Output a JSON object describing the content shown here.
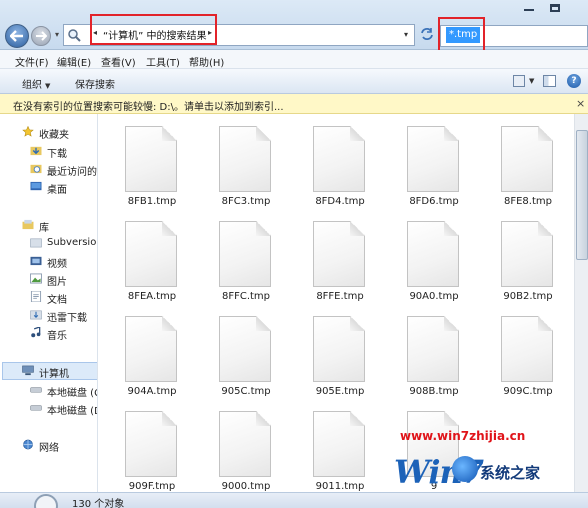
{
  "address": {
    "breadcrumb": "“计算机” 中的搜索结果",
    "search_query": "*.tmp"
  },
  "menu": {
    "items": [
      "文件(F)",
      "编辑(E)",
      "查看(V)",
      "工具(T)",
      "帮助(H)"
    ]
  },
  "toolbar": {
    "organize_label": "组织",
    "save_search_label": "保存搜索"
  },
  "infobar": {
    "text": "在没有索引的位置搜索可能较慢: D:\\。请单击以添加到索引..."
  },
  "nav": {
    "favorites_header": "收藏夹",
    "favorites": [
      "下载",
      "最近访问的",
      "桌面"
    ],
    "libraries_header": "库",
    "libraries": [
      "Subversion",
      "视频",
      "图片",
      "文档",
      "迅雷下载",
      "音乐"
    ],
    "computer_header": "计算机",
    "drives": [
      "本地磁盘 (C",
      "本地磁盘 (D"
    ],
    "network_header": "网络"
  },
  "files": [
    "8FB1.tmp",
    "8FC3.tmp",
    "8FD4.tmp",
    "8FD6.tmp",
    "8FE8.tmp",
    "8FEA.tmp",
    "8FFC.tmp",
    "8FFE.tmp",
    "90A0.tmp",
    "90B2.tmp",
    "904A.tmp",
    "905C.tmp",
    "905E.tmp",
    "908B.tmp",
    "909C.tmp",
    "909F.tmp",
    "9000.tmp",
    "9011.tmp",
    "9"
  ],
  "status": {
    "count_text": "130 个对象"
  },
  "watermark": {
    "url": "www.win7zhijia.cn",
    "brand": "系统之家",
    "logo_text": "Win7"
  },
  "colors": {
    "highlight_box": "#e2232a",
    "selection": "#3399ff",
    "infobar_bg": "#fff8c7"
  }
}
